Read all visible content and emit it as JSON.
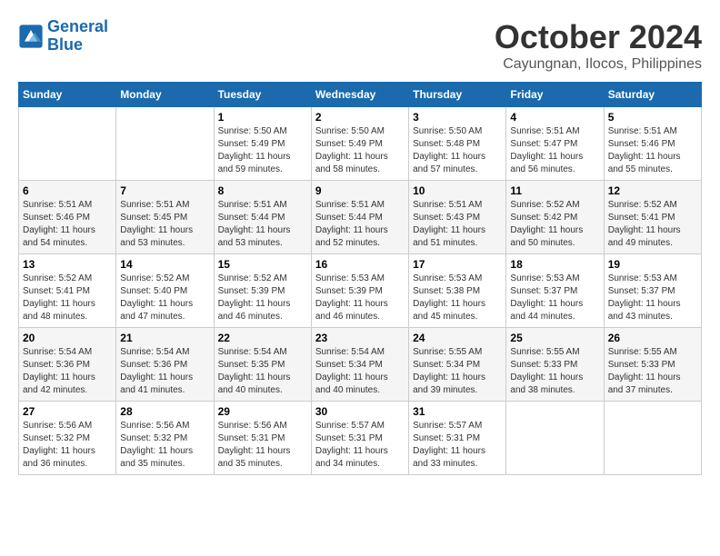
{
  "header": {
    "logo_line1": "General",
    "logo_line2": "Blue",
    "month_title": "October 2024",
    "location": "Cayungnan, Ilocos, Philippines"
  },
  "days_of_week": [
    "Sunday",
    "Monday",
    "Tuesday",
    "Wednesday",
    "Thursday",
    "Friday",
    "Saturday"
  ],
  "weeks": [
    [
      {
        "day": "",
        "sunrise": "",
        "sunset": "",
        "daylight": ""
      },
      {
        "day": "",
        "sunrise": "",
        "sunset": "",
        "daylight": ""
      },
      {
        "day": "1",
        "sunrise": "Sunrise: 5:50 AM",
        "sunset": "Sunset: 5:49 PM",
        "daylight": "Daylight: 11 hours and 59 minutes."
      },
      {
        "day": "2",
        "sunrise": "Sunrise: 5:50 AM",
        "sunset": "Sunset: 5:49 PM",
        "daylight": "Daylight: 11 hours and 58 minutes."
      },
      {
        "day": "3",
        "sunrise": "Sunrise: 5:50 AM",
        "sunset": "Sunset: 5:48 PM",
        "daylight": "Daylight: 11 hours and 57 minutes."
      },
      {
        "day": "4",
        "sunrise": "Sunrise: 5:51 AM",
        "sunset": "Sunset: 5:47 PM",
        "daylight": "Daylight: 11 hours and 56 minutes."
      },
      {
        "day": "5",
        "sunrise": "Sunrise: 5:51 AM",
        "sunset": "Sunset: 5:46 PM",
        "daylight": "Daylight: 11 hours and 55 minutes."
      }
    ],
    [
      {
        "day": "6",
        "sunrise": "Sunrise: 5:51 AM",
        "sunset": "Sunset: 5:46 PM",
        "daylight": "Daylight: 11 hours and 54 minutes."
      },
      {
        "day": "7",
        "sunrise": "Sunrise: 5:51 AM",
        "sunset": "Sunset: 5:45 PM",
        "daylight": "Daylight: 11 hours and 53 minutes."
      },
      {
        "day": "8",
        "sunrise": "Sunrise: 5:51 AM",
        "sunset": "Sunset: 5:44 PM",
        "daylight": "Daylight: 11 hours and 53 minutes."
      },
      {
        "day": "9",
        "sunrise": "Sunrise: 5:51 AM",
        "sunset": "Sunset: 5:44 PM",
        "daylight": "Daylight: 11 hours and 52 minutes."
      },
      {
        "day": "10",
        "sunrise": "Sunrise: 5:51 AM",
        "sunset": "Sunset: 5:43 PM",
        "daylight": "Daylight: 11 hours and 51 minutes."
      },
      {
        "day": "11",
        "sunrise": "Sunrise: 5:52 AM",
        "sunset": "Sunset: 5:42 PM",
        "daylight": "Daylight: 11 hours and 50 minutes."
      },
      {
        "day": "12",
        "sunrise": "Sunrise: 5:52 AM",
        "sunset": "Sunset: 5:41 PM",
        "daylight": "Daylight: 11 hours and 49 minutes."
      }
    ],
    [
      {
        "day": "13",
        "sunrise": "Sunrise: 5:52 AM",
        "sunset": "Sunset: 5:41 PM",
        "daylight": "Daylight: 11 hours and 48 minutes."
      },
      {
        "day": "14",
        "sunrise": "Sunrise: 5:52 AM",
        "sunset": "Sunset: 5:40 PM",
        "daylight": "Daylight: 11 hours and 47 minutes."
      },
      {
        "day": "15",
        "sunrise": "Sunrise: 5:52 AM",
        "sunset": "Sunset: 5:39 PM",
        "daylight": "Daylight: 11 hours and 46 minutes."
      },
      {
        "day": "16",
        "sunrise": "Sunrise: 5:53 AM",
        "sunset": "Sunset: 5:39 PM",
        "daylight": "Daylight: 11 hours and 46 minutes."
      },
      {
        "day": "17",
        "sunrise": "Sunrise: 5:53 AM",
        "sunset": "Sunset: 5:38 PM",
        "daylight": "Daylight: 11 hours and 45 minutes."
      },
      {
        "day": "18",
        "sunrise": "Sunrise: 5:53 AM",
        "sunset": "Sunset: 5:37 PM",
        "daylight": "Daylight: 11 hours and 44 minutes."
      },
      {
        "day": "19",
        "sunrise": "Sunrise: 5:53 AM",
        "sunset": "Sunset: 5:37 PM",
        "daylight": "Daylight: 11 hours and 43 minutes."
      }
    ],
    [
      {
        "day": "20",
        "sunrise": "Sunrise: 5:54 AM",
        "sunset": "Sunset: 5:36 PM",
        "daylight": "Daylight: 11 hours and 42 minutes."
      },
      {
        "day": "21",
        "sunrise": "Sunrise: 5:54 AM",
        "sunset": "Sunset: 5:36 PM",
        "daylight": "Daylight: 11 hours and 41 minutes."
      },
      {
        "day": "22",
        "sunrise": "Sunrise: 5:54 AM",
        "sunset": "Sunset: 5:35 PM",
        "daylight": "Daylight: 11 hours and 40 minutes."
      },
      {
        "day": "23",
        "sunrise": "Sunrise: 5:54 AM",
        "sunset": "Sunset: 5:34 PM",
        "daylight": "Daylight: 11 hours and 40 minutes."
      },
      {
        "day": "24",
        "sunrise": "Sunrise: 5:55 AM",
        "sunset": "Sunset: 5:34 PM",
        "daylight": "Daylight: 11 hours and 39 minutes."
      },
      {
        "day": "25",
        "sunrise": "Sunrise: 5:55 AM",
        "sunset": "Sunset: 5:33 PM",
        "daylight": "Daylight: 11 hours and 38 minutes."
      },
      {
        "day": "26",
        "sunrise": "Sunrise: 5:55 AM",
        "sunset": "Sunset: 5:33 PM",
        "daylight": "Daylight: 11 hours and 37 minutes."
      }
    ],
    [
      {
        "day": "27",
        "sunrise": "Sunrise: 5:56 AM",
        "sunset": "Sunset: 5:32 PM",
        "daylight": "Daylight: 11 hours and 36 minutes."
      },
      {
        "day": "28",
        "sunrise": "Sunrise: 5:56 AM",
        "sunset": "Sunset: 5:32 PM",
        "daylight": "Daylight: 11 hours and 35 minutes."
      },
      {
        "day": "29",
        "sunrise": "Sunrise: 5:56 AM",
        "sunset": "Sunset: 5:31 PM",
        "daylight": "Daylight: 11 hours and 35 minutes."
      },
      {
        "day": "30",
        "sunrise": "Sunrise: 5:57 AM",
        "sunset": "Sunset: 5:31 PM",
        "daylight": "Daylight: 11 hours and 34 minutes."
      },
      {
        "day": "31",
        "sunrise": "Sunrise: 5:57 AM",
        "sunset": "Sunset: 5:31 PM",
        "daylight": "Daylight: 11 hours and 33 minutes."
      },
      {
        "day": "",
        "sunrise": "",
        "sunset": "",
        "daylight": ""
      },
      {
        "day": "",
        "sunrise": "",
        "sunset": "",
        "daylight": ""
      }
    ]
  ]
}
